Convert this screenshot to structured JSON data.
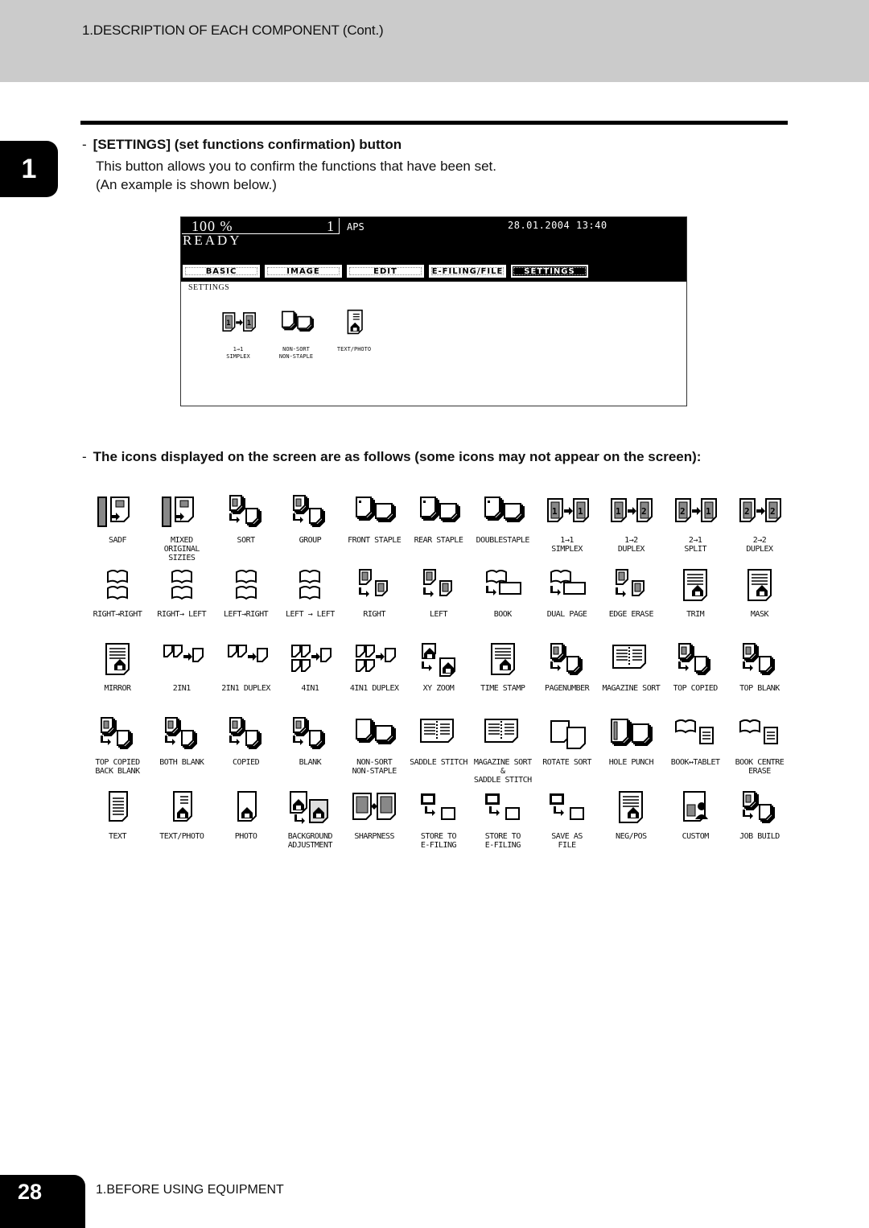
{
  "header": {
    "title": "1.DESCRIPTION OF EACH COMPONENT (Cont.)"
  },
  "chapter_tab": "1",
  "section": {
    "bullet": "-",
    "heading": "[SETTINGS] (set functions confirmation) button",
    "desc_line1": "This button allows you to confirm the functions that have been set.",
    "desc_line2": "(An example is shown below.)"
  },
  "screen": {
    "zoom": "100  %",
    "copies": "1",
    "paper": "APS",
    "datetime": "28.01.2004 13:40",
    "status": "READY",
    "tabs": [
      {
        "label": "BASIC",
        "active": false
      },
      {
        "label": "IMAGE",
        "active": false
      },
      {
        "label": "EDIT",
        "active": false
      },
      {
        "label": "E-FILING/FILE",
        "active": false
      },
      {
        "label": "SETTINGS",
        "active": true
      }
    ],
    "panel_label": "SETTINGS",
    "icons": [
      {
        "icon": "simplex-1to1-icon",
        "label": "1→1\nSIMPLEX"
      },
      {
        "icon": "non-sort-non-staple-icon",
        "label": "NON-SORT\nNON-STAPLE"
      },
      {
        "icon": "text-photo-icon",
        "label": "TEXT/PHOTO"
      }
    ]
  },
  "icon_list": {
    "bullet": "-",
    "heading": "The icons displayed on the screen are as follows (some icons may not appear on the screen):",
    "rows": [
      [
        {
          "icon": "sadf-icon",
          "label": "SADF"
        },
        {
          "icon": "mixed-original-sizes-icon",
          "label": "MIXED\nORIGINAL SIZIES"
        },
        {
          "icon": "sort-icon",
          "label": "SORT"
        },
        {
          "icon": "group-icon",
          "label": "GROUP"
        },
        {
          "icon": "front-staple-icon",
          "label": "FRONT STAPLE"
        },
        {
          "icon": "rear-staple-icon",
          "label": "REAR STAPLE"
        },
        {
          "icon": "double-staple-icon",
          "label": "DOUBLESTAPLE"
        },
        {
          "icon": "simplex-1to1-icon",
          "label": "1→1\nSIMPLEX"
        },
        {
          "icon": "duplex-1to2-icon",
          "label": "1→2\nDUPLEX"
        },
        {
          "icon": "split-2to1-icon",
          "label": "2→1\nSPLIT"
        },
        {
          "icon": "duplex-2to2-icon",
          "label": "2→2\nDUPLEX"
        }
      ],
      [
        {
          "icon": "book-right-right-icon",
          "label": "RIGHT→RIGHT"
        },
        {
          "icon": "book-right-left-icon",
          "label": "RIGHT→ LEFT"
        },
        {
          "icon": "book-left-right-icon",
          "label": "LEFT→RIGHT"
        },
        {
          "icon": "book-left-left-icon",
          "label": "LEFT → LEFT"
        },
        {
          "icon": "right-icon",
          "label": "RIGHT"
        },
        {
          "icon": "left-icon",
          "label": "LEFT"
        },
        {
          "icon": "book-icon",
          "label": "BOOK"
        },
        {
          "icon": "dual-page-icon",
          "label": "DUAL PAGE"
        },
        {
          "icon": "edge-erase-icon",
          "label": "EDGE ERASE"
        },
        {
          "icon": "trim-icon",
          "label": "TRIM"
        },
        {
          "icon": "mask-icon",
          "label": "MASK"
        }
      ],
      [
        {
          "icon": "mirror-icon",
          "label": "MIRROR"
        },
        {
          "icon": "2in1-icon",
          "label": "2IN1"
        },
        {
          "icon": "2in1-duplex-icon",
          "label": "2IN1 DUPLEX"
        },
        {
          "icon": "4in1-icon",
          "label": "4IN1"
        },
        {
          "icon": "4in1-duplex-icon",
          "label": "4IN1 DUPLEX"
        },
        {
          "icon": "xy-zoom-icon",
          "label": "XY ZOOM"
        },
        {
          "icon": "time-stamp-icon",
          "label": "TIME STAMP"
        },
        {
          "icon": "page-number-icon",
          "label": "PAGENUMBER"
        },
        {
          "icon": "magazine-sort-icon",
          "label": "MAGAZINE SORT"
        },
        {
          "icon": "top-copied-icon",
          "label": "TOP COPIED"
        },
        {
          "icon": "top-blank-icon",
          "label": "TOP BLANK"
        }
      ],
      [
        {
          "icon": "top-copied-back-blank-icon",
          "label": "TOP COPIED\nBACK BLANK"
        },
        {
          "icon": "both-blank-icon",
          "label": "BOTH BLANK"
        },
        {
          "icon": "copied-icon",
          "label": "COPIED"
        },
        {
          "icon": "blank-icon",
          "label": "BLANK"
        },
        {
          "icon": "non-sort-non-staple-icon",
          "label": "NON-SORT\nNON-STAPLE"
        },
        {
          "icon": "saddle-stitch-icon",
          "label": "SADDLE STITCH"
        },
        {
          "icon": "magazine-sort-saddle-stitch-icon",
          "label": "MAGAZINE SORT\n&\nSADDLE STITCH"
        },
        {
          "icon": "rotate-sort-icon",
          "label": "ROTATE SORT"
        },
        {
          "icon": "hole-punch-icon",
          "label": "HOLE PUNCH"
        },
        {
          "icon": "book-tablet-icon",
          "label": "BOOK↔TABLET"
        },
        {
          "icon": "book-centre-erase-icon",
          "label": "BOOK CENTRE\nERASE"
        }
      ],
      [
        {
          "icon": "text-icon",
          "label": "TEXT"
        },
        {
          "icon": "text-photo-icon",
          "label": "TEXT/PHOTO"
        },
        {
          "icon": "photo-icon",
          "label": "PHOTO"
        },
        {
          "icon": "background-adjustment-icon",
          "label": "BACKGROUND\nADJUSTMENT"
        },
        {
          "icon": "sharpness-icon",
          "label": "SHARPNESS"
        },
        {
          "icon": "store-to-efiling-icon",
          "label": "STORE TO\nE-FILING"
        },
        {
          "icon": "copy-and-store-to-efiling-icon",
          "label": "STORE TO\nE-FILING"
        },
        {
          "icon": "save-as-file-icon",
          "label": "SAVE AS\nFILE"
        },
        {
          "icon": "neg-pos-icon",
          "label": "NEG/POS"
        },
        {
          "icon": "custom-icon",
          "label": "CUSTOM"
        },
        {
          "icon": "job-build-icon",
          "label": "JOB BUILD"
        }
      ]
    ]
  },
  "footer": {
    "page_number": "28",
    "chapter_title": "1.BEFORE USING EQUIPMENT"
  }
}
